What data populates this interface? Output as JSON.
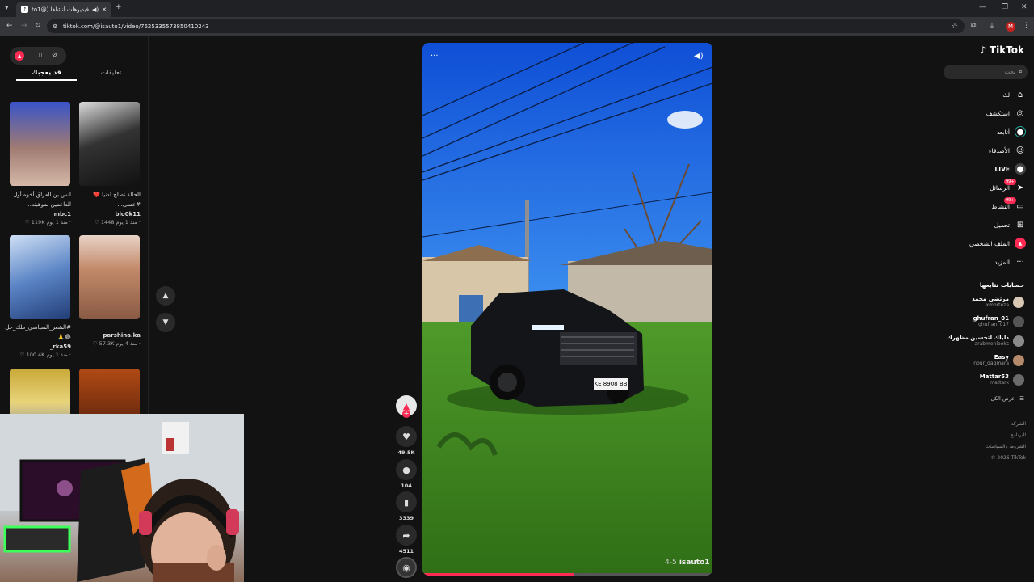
{
  "browser": {
    "tab_title": "فيديوهات أنشأها (@isauto1)",
    "url": "tiktok.com/@isauto1/video/7625335573850410243",
    "profile_letter": "M"
  },
  "left_panel": {
    "tab_active": "قد يعجبك",
    "tab_other": "تعليقات",
    "videos": [
      {
        "caption": "الحالة تصلح لدنيا ❤️ #عسى...",
        "user": "blo0k11",
        "meta": "منذ 1 يوم ·",
        "likes": "1448"
      },
      {
        "caption": "انس بن العراق أخوه أول الداعمين لموهبته...",
        "user": "mbc1",
        "meta": "منذ 1 يوم ·",
        "likes": "119K"
      },
      {
        "caption": "",
        "user": "parshina.ka",
        "meta": "منذ 4 يوم ·",
        "likes": "57.3K"
      },
      {
        "caption": "#الشعر_السياسي_ملك_حل 😂🙏",
        "user": "rka59_",
        "meta": "منذ 1 يوم ·",
        "likes": "100.4K"
      }
    ]
  },
  "video": {
    "watermark_user": "isauto1",
    "watermark_id": "4-5",
    "plate": "KE 8908 BB",
    "progress": 0.52
  },
  "actions": {
    "likes": "49.5K",
    "comments": "104",
    "saves": "3339",
    "shares": "4511"
  },
  "sidebar": {
    "logo": "TikTok",
    "search_placeholder": "بحث",
    "items": [
      {
        "label": "لك",
        "icon": "home-icon",
        "glyph": "⌂"
      },
      {
        "label": "استكشف",
        "icon": "compass-icon",
        "glyph": "◎"
      },
      {
        "label": "أتابعه",
        "icon": "following-icon",
        "glyph": "●"
      },
      {
        "label": "الأصدقاء",
        "icon": "friends-icon",
        "glyph": "☺"
      },
      {
        "label": "LIVE",
        "icon": "live-icon",
        "glyph": "●"
      },
      {
        "label": "الرسائل",
        "icon": "messages-icon",
        "glyph": "➤"
      },
      {
        "label": "النشاط",
        "icon": "activity-icon",
        "glyph": "▭"
      },
      {
        "label": "تحميل",
        "icon": "upload-icon",
        "glyph": "⊞"
      },
      {
        "label": "الملف الشخصي",
        "icon": "profile-icon",
        "glyph": "▲"
      },
      {
        "label": "المزيد",
        "icon": "more-icon",
        "glyph": "···"
      }
    ],
    "badge_messages": "99+",
    "badge_activity": "99+",
    "following_title": "حسابات تتابعها",
    "following": [
      {
        "name": "مرتضى محمد",
        "handle": "xmortezа"
      },
      {
        "name": "ghufran_01",
        "handle": "ghufran_017"
      },
      {
        "name": "دليلك لتحسين مظهرك",
        "handle": "arabmenlooks"
      },
      {
        "name": "Easy",
        "handle": "nour_qaqmara"
      },
      {
        "name": "Mattar53",
        "handle": "mattarx"
      }
    ],
    "see_all": "عرض الكل",
    "footer": [
      "الشركة",
      "البرنامج",
      "الشروط والسياسات",
      "© 2026 TikTok"
    ]
  }
}
